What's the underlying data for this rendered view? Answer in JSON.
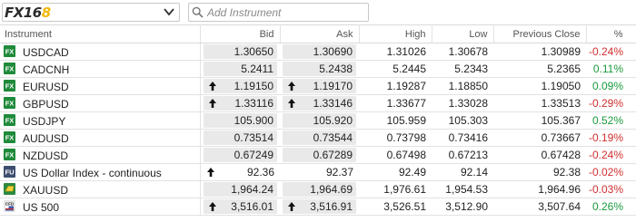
{
  "header": {
    "logo_main": "FX16",
    "logo_accent": "8",
    "search_placeholder": "Add Instrument"
  },
  "columns": {
    "instrument": "Instrument",
    "bid": "Bid",
    "ask": "Ask",
    "high": "High",
    "low": "Low",
    "prev_close": "Previous Close",
    "change": "%"
  },
  "colors": {
    "positive": "#1a9a3c",
    "negative": "#d12f2f",
    "fx_badge": "#1e8a3a",
    "fu_badge": "#3d4d6e",
    "cfd_badge": "#e6e6e6"
  },
  "rows": [
    {
      "badge": "FX",
      "badge_icon": "fx-icon",
      "name": "USDCAD",
      "bid": "1.30650",
      "ask": "1.30690",
      "bid_arrow": false,
      "ask_arrow": false,
      "pill": true,
      "high": "1.31026",
      "low": "1.30678",
      "prev": "1.30989",
      "chg": "-0.24%",
      "dir": "neg"
    },
    {
      "badge": "FX",
      "badge_icon": "fx-icon",
      "name": "CADCNH",
      "bid": "5.2411",
      "ask": "5.2438",
      "bid_arrow": false,
      "ask_arrow": false,
      "pill": true,
      "high": "5.2445",
      "low": "5.2343",
      "prev": "5.2365",
      "chg": "0.11%",
      "dir": "pos"
    },
    {
      "badge": "FX",
      "badge_icon": "fx-icon",
      "name": "EURUSD",
      "bid": "1.19150",
      "ask": "1.19170",
      "bid_arrow": true,
      "ask_arrow": true,
      "pill": true,
      "high": "1.19287",
      "low": "1.18850",
      "prev": "1.19050",
      "chg": "0.09%",
      "dir": "pos"
    },
    {
      "badge": "FX",
      "badge_icon": "fx-icon",
      "name": "GBPUSD",
      "bid": "1.33116",
      "ask": "1.33146",
      "bid_arrow": true,
      "ask_arrow": true,
      "pill": true,
      "high": "1.33677",
      "low": "1.33028",
      "prev": "1.33513",
      "chg": "-0.29%",
      "dir": "neg"
    },
    {
      "badge": "FX",
      "badge_icon": "fx-icon",
      "name": "USDJPY",
      "bid": "105.900",
      "ask": "105.920",
      "bid_arrow": false,
      "ask_arrow": false,
      "pill": true,
      "high": "105.959",
      "low": "105.303",
      "prev": "105.367",
      "chg": "0.52%",
      "dir": "pos"
    },
    {
      "badge": "FX",
      "badge_icon": "fx-icon",
      "name": "AUDUSD",
      "bid": "0.73514",
      "ask": "0.73544",
      "bid_arrow": false,
      "ask_arrow": false,
      "pill": true,
      "high": "0.73798",
      "low": "0.73416",
      "prev": "0.73667",
      "chg": "-0.19%",
      "dir": "neg"
    },
    {
      "badge": "FX",
      "badge_icon": "fx-icon",
      "name": "NZDUSD",
      "bid": "0.67249",
      "ask": "0.67289",
      "bid_arrow": false,
      "ask_arrow": false,
      "pill": true,
      "high": "0.67498",
      "low": "0.67213",
      "prev": "0.67428",
      "chg": "-0.24%",
      "dir": "neg"
    },
    {
      "badge": "FU",
      "badge_icon": "futures-icon",
      "name": "US Dollar Index - continuous",
      "bid": "92.36",
      "ask": "92.37",
      "bid_arrow": true,
      "ask_arrow": false,
      "pill": false,
      "high": "92.49",
      "low": "92.14",
      "prev": "92.38",
      "chg": "-0.02%",
      "dir": "neg"
    },
    {
      "badge": "",
      "badge_icon": "gold-bar-icon",
      "name": "XAUUSD",
      "bid": "1,964.24",
      "ask": "1,964.69",
      "bid_arrow": false,
      "ask_arrow": false,
      "pill": true,
      "high": "1,976.61",
      "low": "1,954.53",
      "prev": "1,964.96",
      "chg": "-0.03%",
      "dir": "neg"
    },
    {
      "badge": "CFD",
      "badge_icon": "cfd-flag-icon",
      "name": "US 500",
      "bid": "3,516.01",
      "ask": "3,516.91",
      "bid_arrow": true,
      "ask_arrow": true,
      "pill": true,
      "high": "3,526.51",
      "low": "3,512.90",
      "prev": "3,507.64",
      "chg": "0.26%",
      "dir": "pos"
    }
  ]
}
